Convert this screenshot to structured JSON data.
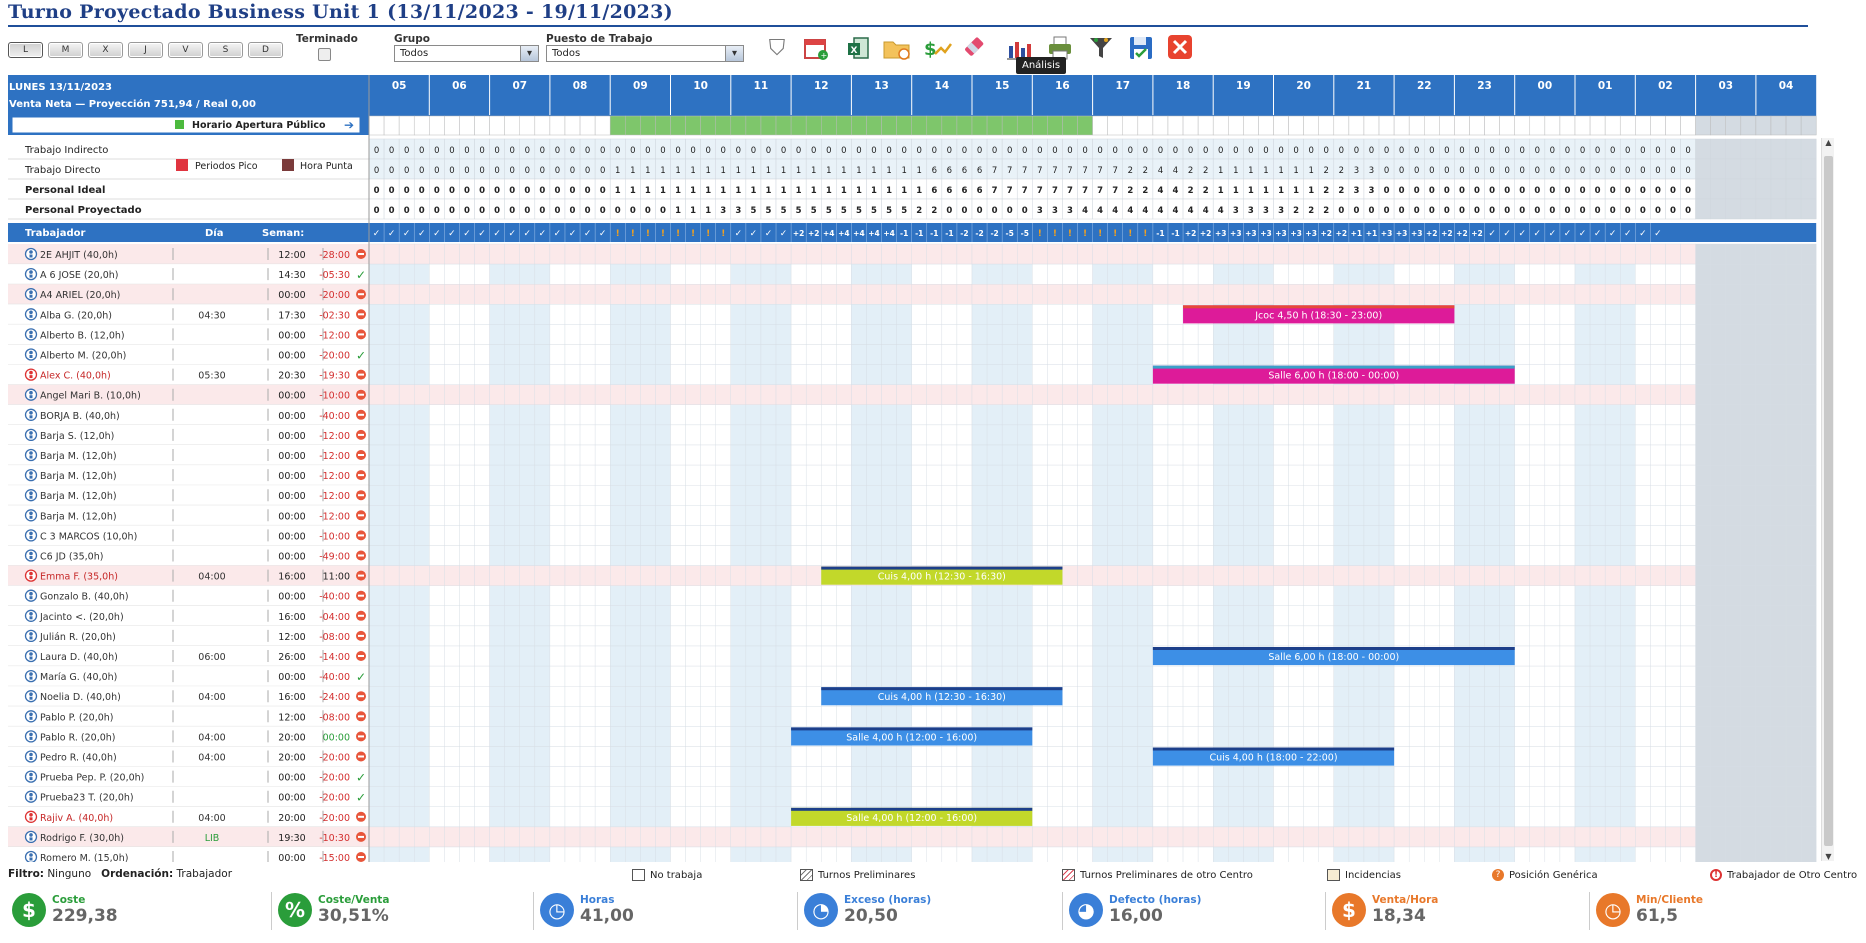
{
  "title": "Turno Proyectado Business Unit 1 (13/11/2023 - 19/11/2023)",
  "day_buttons": [
    "L",
    "M",
    "X",
    "J",
    "V",
    "S",
    "D"
  ],
  "selected_day": "L",
  "terminado_label": "Terminado",
  "grupo": {
    "label": "Grupo",
    "value": "Todos"
  },
  "puesto": {
    "label": "Puesto de Trabajo",
    "value": "Todos"
  },
  "toolbar_icons": [
    "filter-icon",
    "calendar-icon",
    "export-icon",
    "folder-icon",
    "cost-icon",
    "eraser-icon",
    "analysis-chart-icon",
    "print-icon",
    "funnel-config-icon",
    "save-icon",
    "close-icon"
  ],
  "tooltip": "Análisis",
  "colors": {
    "header_blue": "#2e72c2",
    "green_open": "#7ec66b",
    "pink_shift": "#dd1b99",
    "blue_shift": "#3d8fe6",
    "lime_shift": "#c2d82a",
    "peak": "#e0343f",
    "hora_punta": "#7b3b3b"
  },
  "summary": {
    "date": "LUNES 13/11/2023",
    "venta": "Venta Neta  —  Proyección 751,94  /  Real 0,00",
    "apertura": "Horario Apertura Público",
    "trabajo_indirecto": "Trabajo Indirecto",
    "trabajo_directo": "Trabajo Directo",
    "periodos_pico": "Periodos Pico",
    "hora_punta": "Hora Punta",
    "personal_ideal": "Personal Ideal",
    "personal_proyectado": "Personal Proyectado"
  },
  "hours": [
    "05",
    "06",
    "07",
    "08",
    "09",
    "10",
    "11",
    "12",
    "13",
    "14",
    "15",
    "16",
    "17",
    "18",
    "19",
    "20",
    "21",
    "22",
    "23",
    "00",
    "01",
    "02",
    "03",
    "04"
  ],
  "open_range": [
    9,
    17
  ],
  "rows_numbers": {
    "indirecto": "0000000000000000000000000000000000000000000000000000000000000000000000000000000000000000",
    "directo": "0000000000000000111111111111111111111666677777777722442211111112233000000000000000000000",
    "ideal": "0000000000000000111111111111111111111666677777777722442211111112233000000000000000000000",
    "proyectado": "0000000000000000000011133555555555552200000033344444444443333222000000000000000000000000"
  },
  "status_row": [
    "✓",
    "✓",
    "✓",
    "✓",
    "✓",
    "✓",
    "✓",
    "✓",
    "✓",
    "✓",
    "✓",
    "✓",
    "✓",
    "✓",
    "✓",
    "✓",
    "!",
    "!",
    "!",
    "!",
    "!",
    "!",
    "!",
    "!",
    "✓",
    "✓",
    "✓",
    "✓",
    "+2",
    "+2",
    "+4",
    "+4",
    "+4",
    "+4",
    "+4",
    "-1",
    "-1",
    "-1",
    "-1",
    "-2",
    "-2",
    "-2",
    "-5",
    "-5",
    "!",
    "!",
    "!",
    "!",
    "!",
    "!",
    "!",
    "!",
    "-1",
    "-1",
    "+2",
    "+2",
    "+3",
    "+3",
    "+3",
    "+3",
    "+3",
    "+3",
    "+3",
    "+2",
    "+2",
    "+1",
    "+1",
    "+3",
    "+3",
    "+3",
    "+2",
    "+2",
    "+2",
    "+2",
    "✓",
    "✓",
    "✓",
    "✓",
    "✓",
    "✓",
    "✓",
    "✓",
    "✓",
    "✓",
    "✓",
    "✓"
  ],
  "col_headers": {
    "trabajador": "Trabajador",
    "dia": "Día",
    "semana": "Seman:"
  },
  "workers": [
    {
      "name": "2E AHJIT (40,0h)",
      "dia": "",
      "sem": "12:00",
      "bal": "-28:00",
      "st": "x",
      "red": false
    },
    {
      "name": "A 6 JOSE (20,0h)",
      "dia": "",
      "sem": "14:30",
      "bal": "-05:30",
      "st": "ok",
      "red": false
    },
    {
      "name": "A4 ARIEL (20,0h)",
      "dia": "",
      "sem": "00:00",
      "bal": "-20:00",
      "st": "x",
      "red": false
    },
    {
      "name": "Alba G. (20,0h)",
      "dia": "04:30",
      "sem": "17:30",
      "bal": "-02:30",
      "st": "x",
      "red": false
    },
    {
      "name": "Alberto B. (12,0h)",
      "dia": "",
      "sem": "00:00",
      "bal": "-12:00",
      "st": "x",
      "red": false
    },
    {
      "name": "Alberto M. (20,0h)",
      "dia": "",
      "sem": "00:00",
      "bal": "-20:00",
      "st": "ok",
      "red": false
    },
    {
      "name": "Alex C. (40,0h)",
      "dia": "05:30",
      "sem": "20:30",
      "bal": "-19:30",
      "st": "x",
      "red": true
    },
    {
      "name": "Angel Mari B. (10,0h)",
      "dia": "",
      "sem": "00:00",
      "bal": "-10:00",
      "st": "x",
      "red": false
    },
    {
      "name": "BORJA B. (40,0h)",
      "dia": "",
      "sem": "00:00",
      "bal": "-40:00",
      "st": "x",
      "red": false
    },
    {
      "name": "Barja S. (12,0h)",
      "dia": "",
      "sem": "00:00",
      "bal": "-12:00",
      "st": "x",
      "red": false
    },
    {
      "name": "Barja M. (12,0h)",
      "dia": "",
      "sem": "00:00",
      "bal": "-12:00",
      "st": "x",
      "red": false
    },
    {
      "name": "Barja M. (12,0h)",
      "dia": "",
      "sem": "00:00",
      "bal": "-12:00",
      "st": "x",
      "red": false
    },
    {
      "name": "Barja M. (12,0h)",
      "dia": "",
      "sem": "00:00",
      "bal": "-12:00",
      "st": "x",
      "red": false
    },
    {
      "name": "Barja M. (12,0h)",
      "dia": "",
      "sem": "00:00",
      "bal": "-12:00",
      "st": "x",
      "red": false
    },
    {
      "name": "C 3 MARCOS (10,0h)",
      "dia": "",
      "sem": "00:00",
      "bal": "-10:00",
      "st": "x",
      "red": false
    },
    {
      "name": "C6 JD (35,0h)",
      "dia": "",
      "sem": "00:00",
      "bal": "-49:00",
      "st": "x",
      "red": false
    },
    {
      "name": "Emma F. (35,0h)",
      "dia": "04:00",
      "sem": "16:00",
      "bal": "11:00",
      "st": "x",
      "red": true
    },
    {
      "name": "Gonzalo B. (40,0h)",
      "dia": "",
      "sem": "00:00",
      "bal": "-40:00",
      "st": "x",
      "red": false
    },
    {
      "name": "Jacinto <. (20,0h)",
      "dia": "",
      "sem": "16:00",
      "bal": "-04:00",
      "st": "x",
      "red": false
    },
    {
      "name": "Julián R. (20,0h)",
      "dia": "",
      "sem": "12:00",
      "bal": "-08:00",
      "st": "x",
      "red": false
    },
    {
      "name": "Laura D. (40,0h)",
      "dia": "06:00",
      "sem": "26:00",
      "bal": "-14:00",
      "st": "x",
      "red": false
    },
    {
      "name": "María G. (40,0h)",
      "dia": "",
      "sem": "00:00",
      "bal": "-40:00",
      "st": "ok",
      "red": false
    },
    {
      "name": "Noelia D. (40,0h)",
      "dia": "04:00",
      "sem": "16:00",
      "bal": "-24:00",
      "st": "x",
      "red": false
    },
    {
      "name": "Pablo P. (20,0h)",
      "dia": "",
      "sem": "12:00",
      "bal": "-08:00",
      "st": "x",
      "red": false
    },
    {
      "name": "Pablo R. (20,0h)",
      "dia": "04:00",
      "sem": "20:00",
      "bal": "00:00",
      "st": "x",
      "red": false
    },
    {
      "name": "Pedro R. (40,0h)",
      "dia": "04:00",
      "sem": "20:00",
      "bal": "-20:00",
      "st": "x",
      "red": false
    },
    {
      "name": "Prueba Pep. P. (20,0h)",
      "dia": "",
      "sem": "00:00",
      "bal": "-20:00",
      "st": "ok",
      "red": false
    },
    {
      "name": "Prueba23 T. (20,0h)",
      "dia": "",
      "sem": "00:00",
      "bal": "-20:00",
      "st": "ok",
      "red": false
    },
    {
      "name": "Rajiv A. (40,0h)",
      "dia": "04:00",
      "sem": "20:00",
      "bal": "-20:00",
      "st": "x",
      "red": true
    },
    {
      "name": "Rodrigo F. (30,0h)",
      "dia": "LIB",
      "sem": "19:30",
      "bal": "-10:30",
      "st": "x",
      "red": false
    },
    {
      "name": "Romero M. (15,0h)",
      "dia": "",
      "sem": "00:00",
      "bal": "-15:00",
      "st": "x",
      "red": false
    }
  ],
  "shifts": [
    {
      "row": 3,
      "start": 18.5,
      "end": 23.0,
      "label": "Jcoc 4,50 h (18:30 - 23:00)",
      "color": "pink"
    },
    {
      "row": 6,
      "start": 18.0,
      "end": 24.0,
      "label": "Salle 6,00 h (18:00 - 00:00)",
      "color": "pink"
    },
    {
      "row": 16,
      "start": 12.5,
      "end": 16.5,
      "label": "Cuis 4,00 h (12:30 - 16:30)",
      "color": "lime"
    },
    {
      "row": 20,
      "start": 18.0,
      "end": 24.0,
      "label": "Salle 6,00 h (18:00 - 00:00)",
      "color": "blue"
    },
    {
      "row": 22,
      "start": 12.5,
      "end": 16.5,
      "label": "Cuis 4,00 h (12:30 - 16:30)",
      "color": "blue"
    },
    {
      "row": 24,
      "start": 12.0,
      "end": 16.0,
      "label": "Salle 4,00 h (12:00 - 16:00)",
      "color": "blue"
    },
    {
      "row": 25,
      "start": 18.0,
      "end": 22.0,
      "label": "Cuis 4,00 h (18:00 - 22:00)",
      "color": "blue"
    },
    {
      "row": 28,
      "start": 12.0,
      "end": 16.0,
      "label": "Salle 4,00 h (12:00 - 16:00)",
      "color": "lime"
    }
  ],
  "footer": {
    "filtro_label": "Filtro:",
    "filtro_value": "Ninguno",
    "orden_label": "Ordenación:",
    "orden_value": "Trabajador",
    "legend": [
      "No trabaja",
      "Turnos Preliminares",
      "Turnos Preliminares de otro Centro",
      "Incidencias",
      "Posición Genérica",
      "Trabajador de Otro Centro"
    ]
  },
  "kpis": [
    {
      "label": "Coste",
      "value": "229,38",
      "icon": "dollar-icon",
      "color": "#2a9d3a"
    },
    {
      "label": "Coste/Venta",
      "value": "30,51%",
      "icon": "percent-icon",
      "color": "#2a9d3a"
    },
    {
      "label": "Horas",
      "value": "41,00",
      "icon": "clock-icon",
      "color": "#3a7fd8"
    },
    {
      "label": "Exceso (horas)",
      "value": "20,50",
      "icon": "clock-plus-icon",
      "color": "#3a7fd8"
    },
    {
      "label": "Defecto (horas)",
      "value": "16,00",
      "icon": "clock-minus-icon",
      "color": "#3a7fd8"
    },
    {
      "label": "Venta/Hora",
      "value": "18,34",
      "icon": "sales-hour-icon",
      "color": "#e8782a"
    },
    {
      "label": "Min/Cliente",
      "value": "61,5",
      "icon": "min-client-icon",
      "color": "#e8782a"
    }
  ]
}
